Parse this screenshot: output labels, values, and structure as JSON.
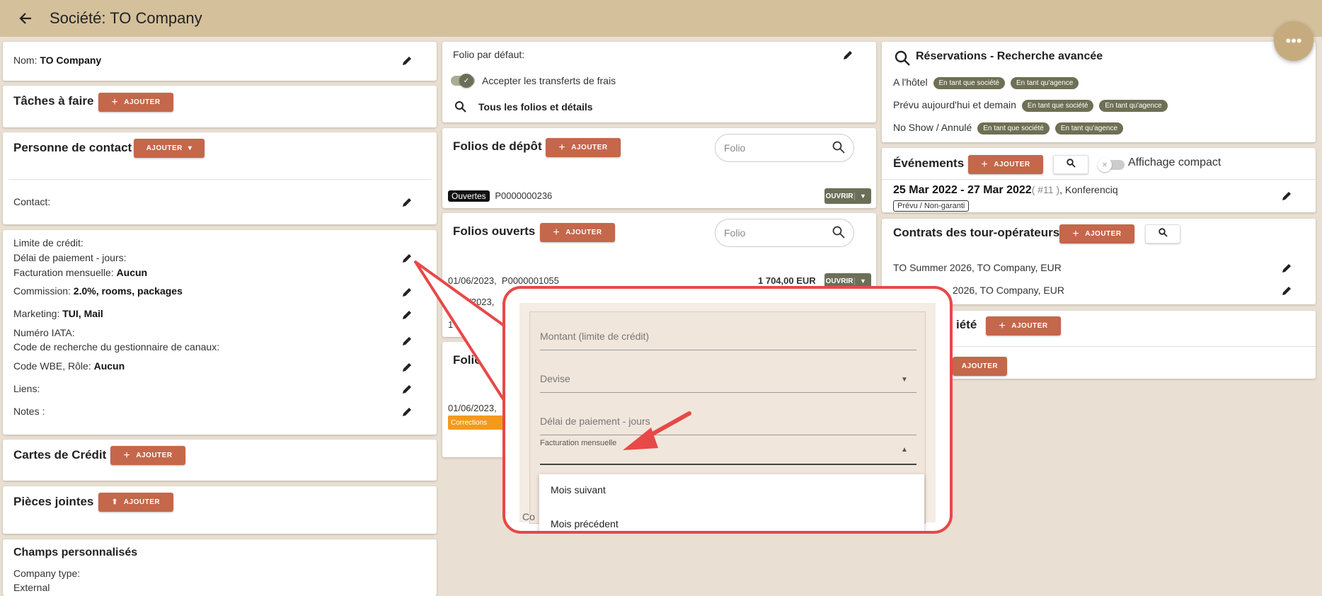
{
  "header": {
    "title": "Société: TO Company"
  },
  "company": {
    "name_label": "Nom:",
    "name_value": "TO Company"
  },
  "tasks": {
    "title": "Tâches à faire",
    "add_label": "AJOUTER"
  },
  "contacts": {
    "title": "Personne de contact",
    "add_label": "AJOUTER",
    "contact_label": "Contact:"
  },
  "details": {
    "credit_limit": "Limite de crédit:",
    "payment_delay": "Délai de paiement - jours:",
    "monthly_billing_label": "Facturation mensuelle:",
    "monthly_billing_value": "Aucun",
    "commission_label": "Commission:",
    "commission_value": "2.0%, rooms, packages",
    "marketing_label": "Marketing:",
    "marketing_value": "TUI, Mail",
    "iata": "Numéro IATA:",
    "channel_code": "Code de recherche du gestionnaire de canaux:",
    "wbe_label": "Code WBE, Rôle:",
    "wbe_value": "Aucun",
    "links": "Liens:",
    "notes": "Notes :"
  },
  "credit_cards": {
    "title": "Cartes de Crédit",
    "add_label": "AJOUTER"
  },
  "attachments": {
    "title": "Pièces jointes",
    "add_label": "AJOUTER"
  },
  "custom_fields": {
    "title": "Champs personnalisés",
    "company_type": "Company type:",
    "external": "External"
  },
  "folio_settings": {
    "default_folio": "Folio par défaut:",
    "accept_transfers": "Accepter les transferts de frais",
    "all_folios": "Tous les folios et détails"
  },
  "deposit_folios": {
    "title": "Folios de dépôt",
    "add_label": "AJOUTER",
    "search_placeholder": "Folio",
    "row_badge": "Ouvertes",
    "row_number": "P0000000236",
    "open_label": "OUVRIR"
  },
  "open_folios": {
    "title": "Folios ouverts",
    "add_label": "AJOUTER",
    "search_placeholder": "Folio",
    "row1_date": "01/06/2023,",
    "row1_number": "P0000001055",
    "row1_amount": "1 704,00 EUR",
    "open_label": "OUVRIR",
    "row2_partial": "0/2023,",
    "row3_partial": "1"
  },
  "folios_other": {
    "title_partial": "Folio",
    "row_date": "01/06/2023,",
    "corrections": "Corrections"
  },
  "reservations": {
    "title": "Réservations - Recherche avancée",
    "rows": [
      {
        "label": "A l'hôtel",
        "chip1": "En tant que société",
        "chip2": "En tant qu'agence"
      },
      {
        "label": "Prévu aujourd'hui et demain",
        "chip1": "En tant que société",
        "chip2": "En tant qu'agence"
      },
      {
        "label": "No Show / Annulé",
        "chip1": "En tant que société",
        "chip2": "En tant qu'agence"
      }
    ]
  },
  "events": {
    "title": "Événements",
    "add_label": "AJOUTER",
    "compact_label": "Affichage compact",
    "event_dates": "25 Mar 2022 - 27 Mar 2022",
    "event_num": "( #11 )",
    "event_name": ", Konferenciq",
    "event_status": "Prévu / Non-garanti"
  },
  "contracts": {
    "title": "Contrats des tour-opérateurs",
    "add_label": "AJOUTER",
    "row1": "TO Summer 2026, TO Company, EUR",
    "row2": "2026, TO Company, EUR"
  },
  "society": {
    "title_partial": "iété",
    "add_label": "AJOUTER",
    "add_label2": "AJOUTER"
  },
  "popup": {
    "amount_label": "Montant (limite de crédit)",
    "currency_label": "Devise",
    "delay_label": "Délai de paiement - jours",
    "billing_label": "Facturation mensuelle",
    "options": [
      "Mois suivant",
      "Mois précédent"
    ],
    "bottom_partial": "Co"
  },
  "colors": {
    "header": "#d4c09b",
    "accent": "#c4674b",
    "background": "#e9e0d3",
    "callout": "#e84848"
  }
}
